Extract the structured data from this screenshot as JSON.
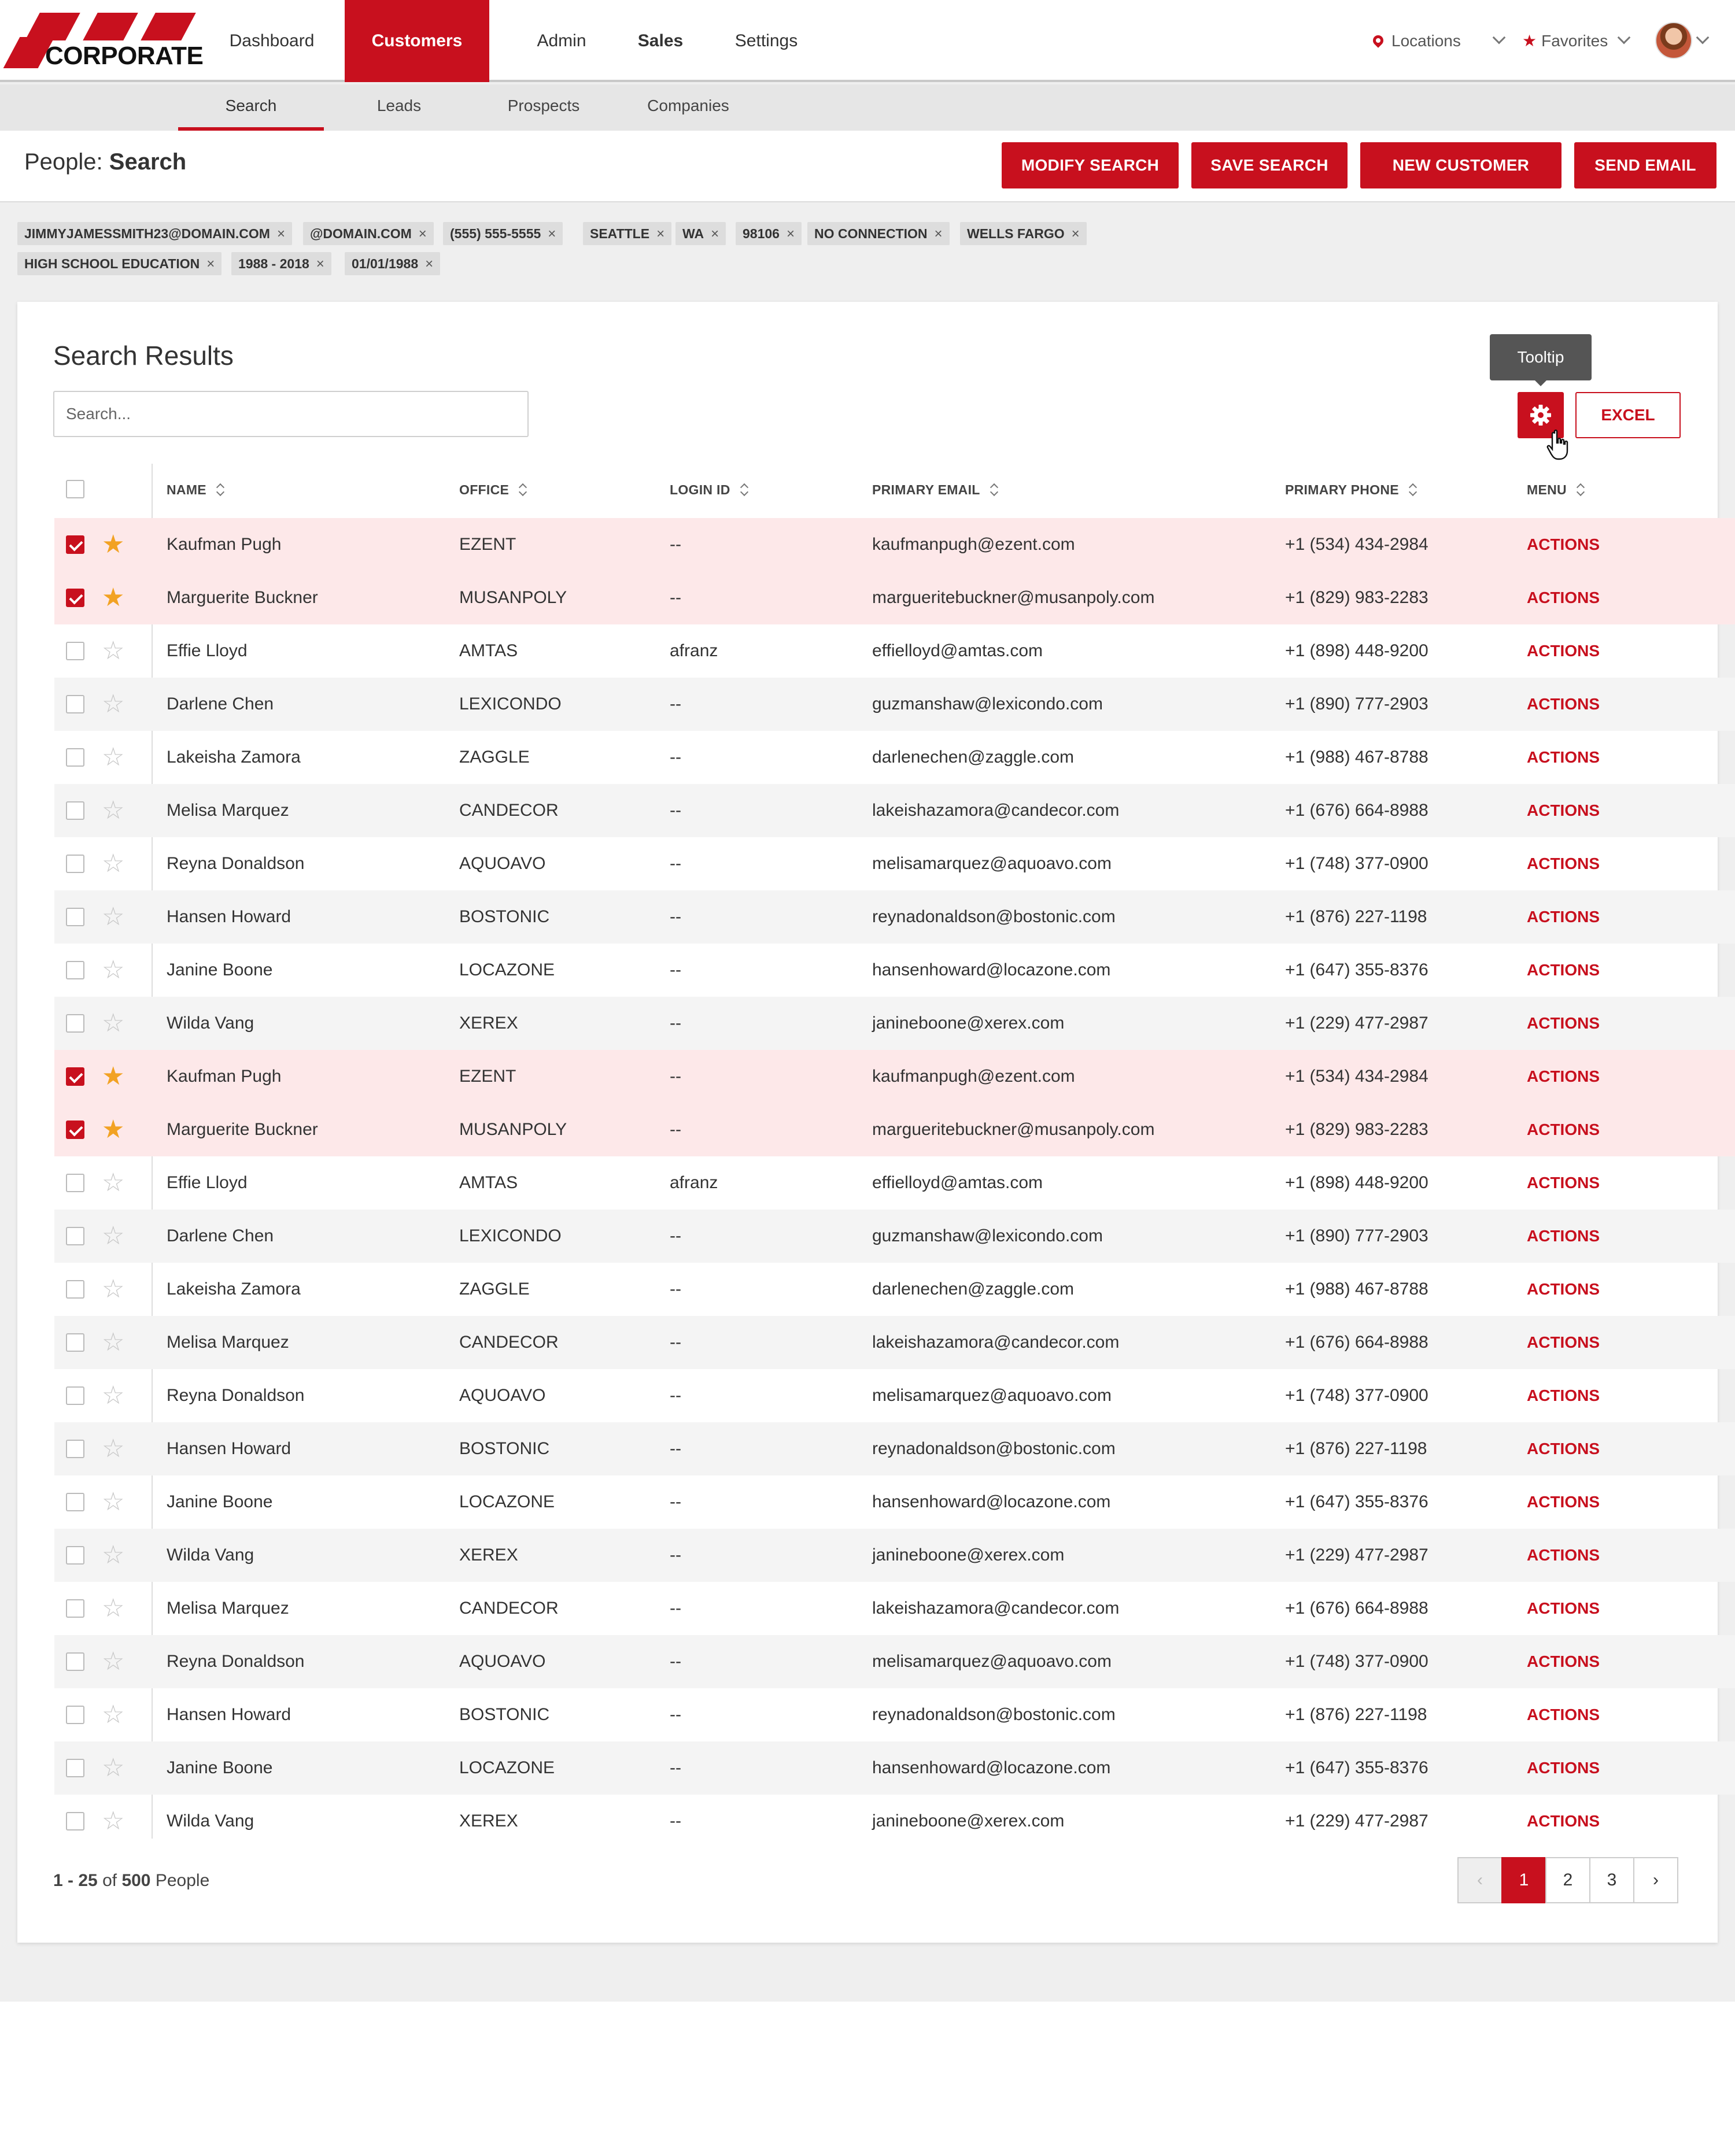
{
  "brand": {
    "name": "CORPORATE"
  },
  "nav": {
    "items": [
      "Dashboard",
      "Customers",
      "Admin",
      "Sales",
      "Settings"
    ],
    "active": "Customers",
    "locations_label": "Locations",
    "favorites_label": "Favorites"
  },
  "subnav": {
    "items": [
      "Search",
      "Leads",
      "Prospects",
      "Companies"
    ],
    "active": "Search"
  },
  "page": {
    "title_prefix": "People:",
    "title": "Search"
  },
  "buttons": {
    "modify": "MODIFY SEARCH",
    "save": "SAVE SEARCH",
    "new_customer": "NEW CUSTOMER",
    "send_email": "SEND EMAIL"
  },
  "filters": [
    "JIMMYJAMESSMITH23@DOMAIN.COM",
    "@DOMAIN.COM",
    "(555) 555-5555",
    "SEATTLE",
    "WA",
    "98106",
    "NO CONNECTION",
    "WELLS FARGO",
    "HIGH SCHOOL EDUCATION",
    "1988 - 2018",
    "01/01/1988"
  ],
  "results": {
    "title": "Search Results",
    "search_placeholder": "Search...",
    "tooltip": "Tooltip",
    "excel_label": "EXCEL",
    "columns": [
      "NAME",
      "OFFICE",
      "LOGIN ID",
      "PRIMARY EMAIL",
      "PRIMARY PHONE",
      "MENU"
    ],
    "rows": [
      {
        "checked": true,
        "favorite": true,
        "name": "Kaufman Pugh",
        "office": "EZENT",
        "login": "--",
        "email": "kaufmanpugh@ezent.com",
        "phone": "+1 (534) 434-2984",
        "menu": "ACTIONS"
      },
      {
        "checked": true,
        "favorite": true,
        "name": "Marguerite Buckner",
        "office": "MUSANPOLY",
        "login": "--",
        "email": "margueritebuckner@musanpoly.com",
        "phone": "+1 (829) 983-2283",
        "menu": "ACTIONS"
      },
      {
        "checked": false,
        "favorite": false,
        "name": "Effie Lloyd",
        "office": "AMTAS",
        "login": "afranz",
        "email": "effielloyd@amtas.com",
        "phone": "+1 (898) 448-9200",
        "menu": "ACTIONS"
      },
      {
        "checked": false,
        "favorite": false,
        "name": "Darlene Chen",
        "office": "LEXICONDO",
        "login": "--",
        "email": "guzmanshaw@lexicondo.com",
        "phone": "+1 (890) 777-2903",
        "menu": "ACTIONS"
      },
      {
        "checked": false,
        "favorite": false,
        "name": "Lakeisha Zamora",
        "office": "ZAGGLE",
        "login": "--",
        "email": "darlenechen@zaggle.com",
        "phone": "+1 (988) 467-8788",
        "menu": "ACTIONS"
      },
      {
        "checked": false,
        "favorite": false,
        "name": "Melisa Marquez",
        "office": "CANDECOR",
        "login": "--",
        "email": "lakeishazamora@candecor.com",
        "phone": "+1 (676) 664-8988",
        "menu": "ACTIONS"
      },
      {
        "checked": false,
        "favorite": false,
        "name": "Reyna Donaldson",
        "office": "AQUOAVO",
        "login": "--",
        "email": "melisamarquez@aquoavo.com",
        "phone": "+1 (748) 377-0900",
        "menu": "ACTIONS"
      },
      {
        "checked": false,
        "favorite": false,
        "name": "Hansen Howard",
        "office": "BOSTONIC",
        "login": "--",
        "email": "reynadonaldson@bostonic.com",
        "phone": "+1 (876) 227-1198",
        "menu": "ACTIONS"
      },
      {
        "checked": false,
        "favorite": false,
        "name": "Janine Boone",
        "office": "LOCAZONE",
        "login": "--",
        "email": "hansenhoward@locazone.com",
        "phone": "+1 (647) 355-8376",
        "menu": "ACTIONS"
      },
      {
        "checked": false,
        "favorite": false,
        "name": "Wilda Vang",
        "office": "XEREX",
        "login": "--",
        "email": "janineboone@xerex.com",
        "phone": "+1 (229) 477-2987",
        "menu": "ACTIONS"
      },
      {
        "checked": true,
        "favorite": true,
        "name": "Kaufman Pugh",
        "office": "EZENT",
        "login": "--",
        "email": "kaufmanpugh@ezent.com",
        "phone": "+1 (534) 434-2984",
        "menu": "ACTIONS"
      },
      {
        "checked": true,
        "favorite": true,
        "name": "Marguerite Buckner",
        "office": "MUSANPOLY",
        "login": "--",
        "email": "margueritebuckner@musanpoly.com",
        "phone": "+1 (829) 983-2283",
        "menu": "ACTIONS"
      },
      {
        "checked": false,
        "favorite": false,
        "name": "Effie Lloyd",
        "office": "AMTAS",
        "login": "afranz",
        "email": "effielloyd@amtas.com",
        "phone": "+1 (898) 448-9200",
        "menu": "ACTIONS"
      },
      {
        "checked": false,
        "favorite": false,
        "name": "Darlene Chen",
        "office": "LEXICONDO",
        "login": "--",
        "email": "guzmanshaw@lexicondo.com",
        "phone": "+1 (890) 777-2903",
        "menu": "ACTIONS"
      },
      {
        "checked": false,
        "favorite": false,
        "name": "Lakeisha Zamora",
        "office": "ZAGGLE",
        "login": "--",
        "email": "darlenechen@zaggle.com",
        "phone": "+1 (988) 467-8788",
        "menu": "ACTIONS"
      },
      {
        "checked": false,
        "favorite": false,
        "name": "Melisa Marquez",
        "office": "CANDECOR",
        "login": "--",
        "email": "lakeishazamora@candecor.com",
        "phone": "+1 (676) 664-8988",
        "menu": "ACTIONS"
      },
      {
        "checked": false,
        "favorite": false,
        "name": "Reyna Donaldson",
        "office": "AQUOAVO",
        "login": "--",
        "email": "melisamarquez@aquoavo.com",
        "phone": "+1 (748) 377-0900",
        "menu": "ACTIONS"
      },
      {
        "checked": false,
        "favorite": false,
        "name": "Hansen Howard",
        "office": "BOSTONIC",
        "login": "--",
        "email": "reynadonaldson@bostonic.com",
        "phone": "+1 (876) 227-1198",
        "menu": "ACTIONS"
      },
      {
        "checked": false,
        "favorite": false,
        "name": "Janine Boone",
        "office": "LOCAZONE",
        "login": "--",
        "email": "hansenhoward@locazone.com",
        "phone": "+1 (647) 355-8376",
        "menu": "ACTIONS"
      },
      {
        "checked": false,
        "favorite": false,
        "name": "Wilda Vang",
        "office": "XEREX",
        "login": "--",
        "email": "janineboone@xerex.com",
        "phone": "+1 (229) 477-2987",
        "menu": "ACTIONS"
      },
      {
        "checked": false,
        "favorite": false,
        "name": "Melisa Marquez",
        "office": "CANDECOR",
        "login": "--",
        "email": "lakeishazamora@candecor.com",
        "phone": "+1 (676) 664-8988",
        "menu": "ACTIONS"
      },
      {
        "checked": false,
        "favorite": false,
        "name": "Reyna Donaldson",
        "office": "AQUOAVO",
        "login": "--",
        "email": "melisamarquez@aquoavo.com",
        "phone": "+1 (748) 377-0900",
        "menu": "ACTIONS"
      },
      {
        "checked": false,
        "favorite": false,
        "name": "Hansen Howard",
        "office": "BOSTONIC",
        "login": "--",
        "email": "reynadonaldson@bostonic.com",
        "phone": "+1 (876) 227-1198",
        "menu": "ACTIONS"
      },
      {
        "checked": false,
        "favorite": false,
        "name": "Janine Boone",
        "office": "LOCAZONE",
        "login": "--",
        "email": "hansenhoward@locazone.com",
        "phone": "+1 (647) 355-8376",
        "menu": "ACTIONS"
      },
      {
        "checked": false,
        "favorite": false,
        "name": "Wilda Vang",
        "office": "XEREX",
        "login": "--",
        "email": "janineboone@xerex.com",
        "phone": "+1 (229) 477-2987",
        "menu": "ACTIONS"
      }
    ]
  },
  "footer": {
    "range": "1 - 25",
    "of": "of",
    "total": "500",
    "unit": "People"
  },
  "pagination": {
    "pages": [
      "1",
      "2",
      "3"
    ],
    "current": "1"
  },
  "colors": {
    "accent": "#c8101e",
    "selected_row": "#fde8e9",
    "favorite": "#f2a223"
  }
}
